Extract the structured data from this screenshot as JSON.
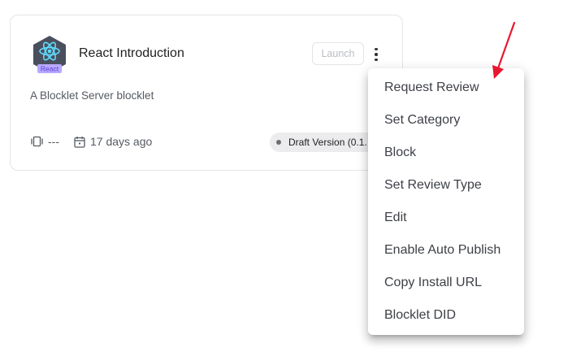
{
  "card": {
    "logo_badge": "React",
    "title": "React Introduction",
    "launch_label": "Launch",
    "description": "A Blocklet Server blocklet",
    "stats_value": "---",
    "updated": "17 days ago",
    "version_badge": "Draft Version (0.1."
  },
  "icons": {
    "logo": "react-logo-icon",
    "more": "more-vertical-icon",
    "stats": "stats-icon",
    "calendar": "calendar-icon",
    "annotation": "red-arrow-icon"
  },
  "menu": {
    "items": [
      {
        "label": "Request Review"
      },
      {
        "label": "Set Category"
      },
      {
        "label": "Block"
      },
      {
        "label": "Set Review Type"
      },
      {
        "label": "Edit"
      },
      {
        "label": "Enable Auto Publish"
      },
      {
        "label": "Copy Install URL"
      },
      {
        "label": "Blocklet DID"
      }
    ]
  },
  "colors": {
    "annotation_arrow": "#e8172f",
    "logo_hex": "#4a4f5e",
    "logo_badge_bg": "#b9a9ff",
    "react_blue": "#61dafb"
  }
}
